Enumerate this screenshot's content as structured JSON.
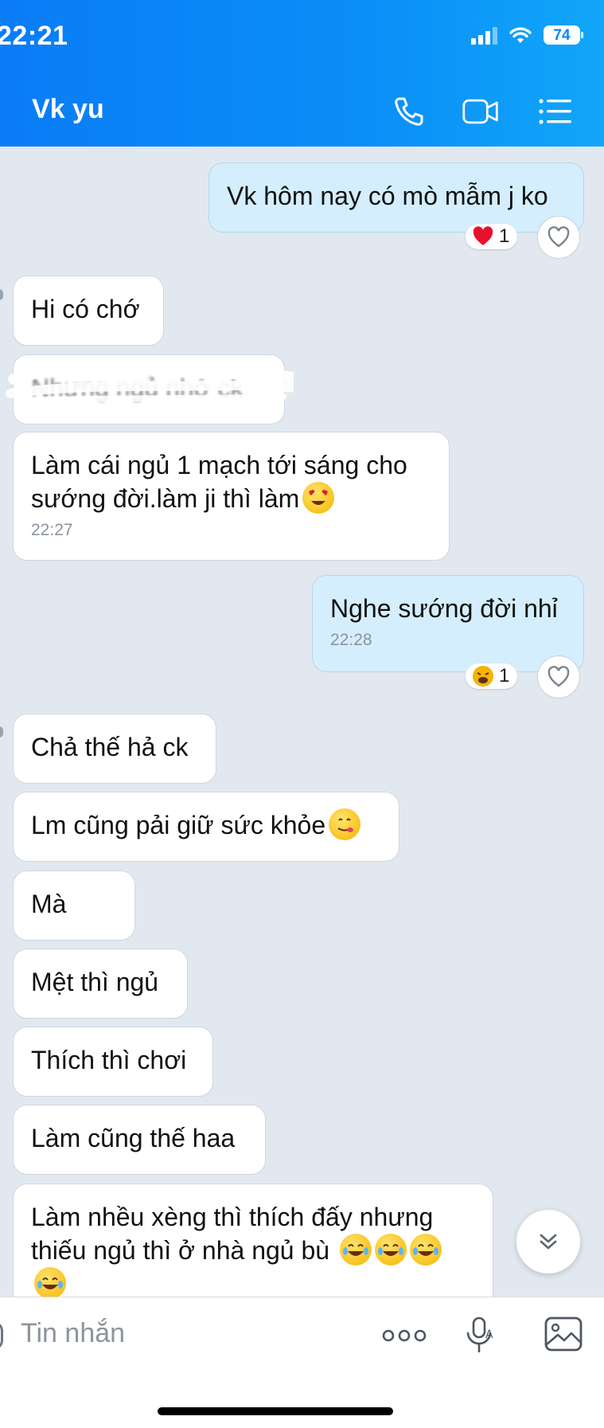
{
  "status_bar": {
    "time": "22:21",
    "battery": "74"
  },
  "header": {
    "title": "Vk yu",
    "call_icon": "phone-icon",
    "video_icon": "video-camera-icon",
    "menu_icon": "list-icon"
  },
  "messages": [
    {
      "text": "Vk hôm nay có mò mẫm j ko",
      "reaction": {
        "emoji": "red-heart",
        "count": "1"
      }
    },
    {
      "text": "Hi có chớ"
    },
    {
      "text": "Nhưng ngủ nhớ ck",
      "redacted": true
    },
    {
      "text": "Làm cái ngủ 1 mạch tới sáng cho sướng đời.làm ji thì làm",
      "emoji": "heart-eyes-emoji",
      "time": "22:27"
    },
    {
      "text": "Nghe sướng đời nhỉ",
      "time": "22:28",
      "reaction": {
        "emoji": "tired-face",
        "count": "1"
      }
    },
    {
      "text": "Chả thế hả ck"
    },
    {
      "text": "Lm cũng pải giữ sức khỏe",
      "emoji": "yum-face-emoji"
    },
    {
      "text": "Mà"
    },
    {
      "text": "Mệt thì ngủ"
    },
    {
      "text": "Thích thì chơi"
    },
    {
      "text": "Làm cũng thế haa"
    },
    {
      "text": "Làm nhều xèng thì thích đấy nhưng thiếu ngủ thì ở nhà ngủ bù",
      "emoji": "tears-of-joy-emoji"
    }
  ],
  "composer": {
    "placeholder": "Tin nhắn"
  },
  "colors": {
    "header": "#0a86f6",
    "outgoing_bubble": "#d4eefd",
    "chat_background": "#e2e8f0"
  }
}
